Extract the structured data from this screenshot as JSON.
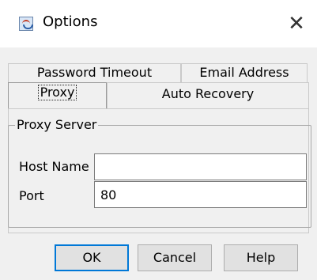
{
  "window": {
    "title": "Options",
    "app_icon": "java-coffee-cup-icon",
    "close_icon": "close-icon",
    "close_glyph": "✕"
  },
  "tabs": [
    {
      "label": "Password Timeout",
      "selected": false
    },
    {
      "label": "Email Address",
      "selected": false
    },
    {
      "label": "Proxy",
      "selected": true
    },
    {
      "label": "Auto Recovery",
      "selected": false
    }
  ],
  "proxy_server": {
    "group_title": "Proxy Server",
    "host_name": {
      "label": "Host Name",
      "value": ""
    },
    "port": {
      "label": "Port",
      "value": "80"
    }
  },
  "buttons": {
    "ok": "OK",
    "cancel": "Cancel",
    "help": "Help"
  },
  "colors": {
    "focus_accent": "#0078d7",
    "dialog_background": "#f0f0f0",
    "title_background": "#ffffff"
  }
}
